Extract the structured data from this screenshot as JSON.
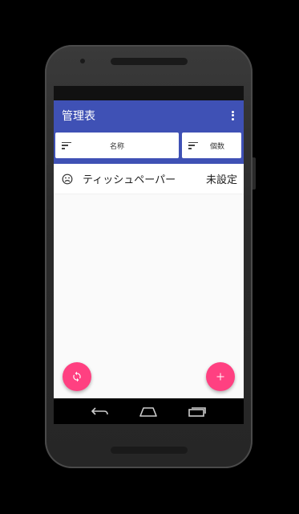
{
  "app": {
    "title": "管理表"
  },
  "sort_bar": {
    "name_label": "名称",
    "count_label": "個数"
  },
  "items": [
    {
      "name": "ティッシュペーパー",
      "status": "未設定",
      "icon": "neutral-face-icon"
    }
  ],
  "fabs": {
    "refresh_icon": "refresh-icon",
    "add_icon": "add-icon"
  },
  "navigation": {
    "back_icon": "back-icon",
    "home_icon": "home-icon",
    "recents_icon": "recents-icon"
  },
  "colors": {
    "primary": "#3f51b5",
    "accent": "#ff4081",
    "background": "#fafafa"
  }
}
